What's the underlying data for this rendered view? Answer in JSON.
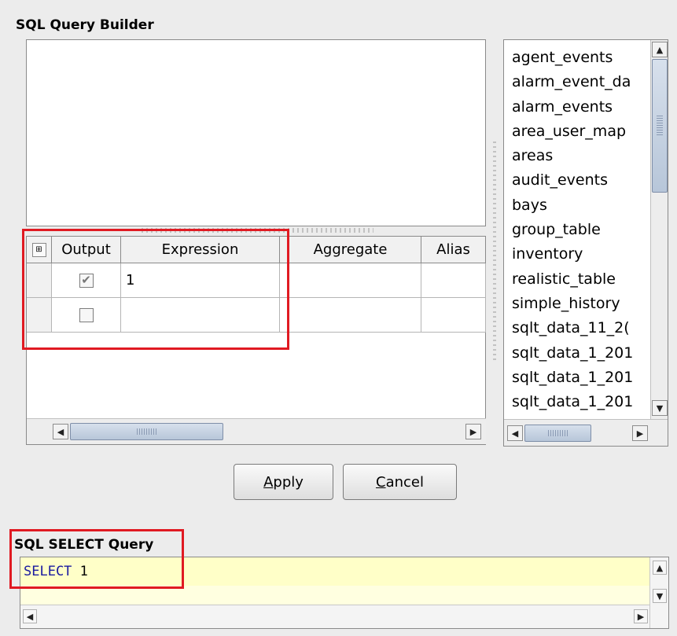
{
  "builder_title": "SQL Query Builder",
  "grid": {
    "corner_icon": "grid-settings-icon",
    "columns": [
      "Output",
      "Expression",
      "Aggregate",
      "Alias"
    ],
    "rows": [
      {
        "output_checked": true,
        "output_mark": "✔",
        "expression": "1",
        "aggregate": "",
        "alias": ""
      },
      {
        "output_checked": false,
        "output_mark": "",
        "expression": "",
        "aggregate": "",
        "alias": ""
      }
    ]
  },
  "tables": {
    "items": [
      "agent_events",
      "alarm_event_da",
      "alarm_events",
      "area_user_map",
      "areas",
      "audit_events",
      "bays",
      "group_table",
      "inventory",
      "realistic_table",
      "simple_history",
      "sqlt_data_11_2(",
      "sqlt_data_1_201",
      "sqlt_data_1_201",
      "sqlt_data_1_201"
    ]
  },
  "buttons": {
    "apply_prefix": "A",
    "apply_rest": "pply",
    "cancel_prefix": "C",
    "cancel_rest": "ancel"
  },
  "query_section": {
    "title": "SQL SELECT Query",
    "keyword": "SELECT",
    "expression": " 1"
  },
  "colors": {
    "highlight": "#e01a22",
    "query_background": "#ffffe0",
    "keyword": "#1a1aa0"
  }
}
